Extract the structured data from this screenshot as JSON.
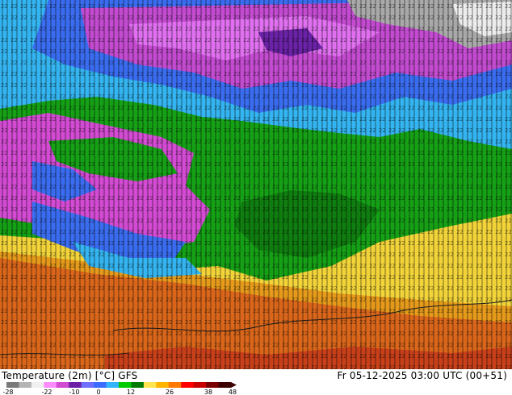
{
  "map": {
    "title": "Temperature (2m) [°C] GFS",
    "valid_time": "Fr 05-12-2025 03:00 UTC (00+51)"
  },
  "legend": {
    "ticks": [
      "-28",
      "-22",
      "-10",
      "0",
      "12",
      "26",
      "38",
      "48"
    ],
    "colors": [
      "#7a7a7a",
      "#b4b4b4",
      "#f0f0f0",
      "#ff8cff",
      "#d24bd2",
      "#6b1ea6",
      "#7070ff",
      "#3b6cff",
      "#32b4ff",
      "#00cc00",
      "#007a00",
      "#ffe650",
      "#ffb400",
      "#ff7800",
      "#ff0000",
      "#c80000",
      "#7a0000",
      "#3c0000"
    ]
  }
}
